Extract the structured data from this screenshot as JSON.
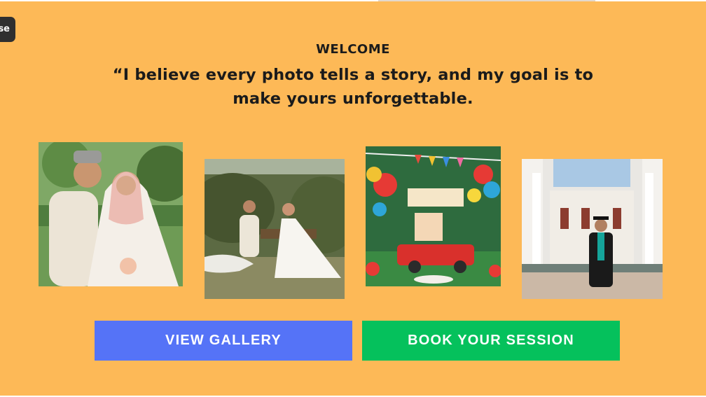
{
  "close_tab": {
    "label": "se"
  },
  "hero": {
    "eyebrow": "WELCOME",
    "quote": "“I believe every photo tells a story, and my goal is to make yours unforgettable."
  },
  "photos": [
    {
      "icon": "wedding-couple-garden-photo"
    },
    {
      "icon": "prewedding-couple-bench-photo"
    },
    {
      "icon": "birthday-party-balloons-photo"
    },
    {
      "icon": "graduation-portrait-photo"
    }
  ],
  "buttons": {
    "gallery_label": "VIEW GALLERY",
    "book_label": "BOOK YOUR SESSION"
  },
  "colors": {
    "background": "#FDB957",
    "gallery_button": "#5573F7",
    "book_button": "#05C15C",
    "text": "#1B1B1B"
  }
}
